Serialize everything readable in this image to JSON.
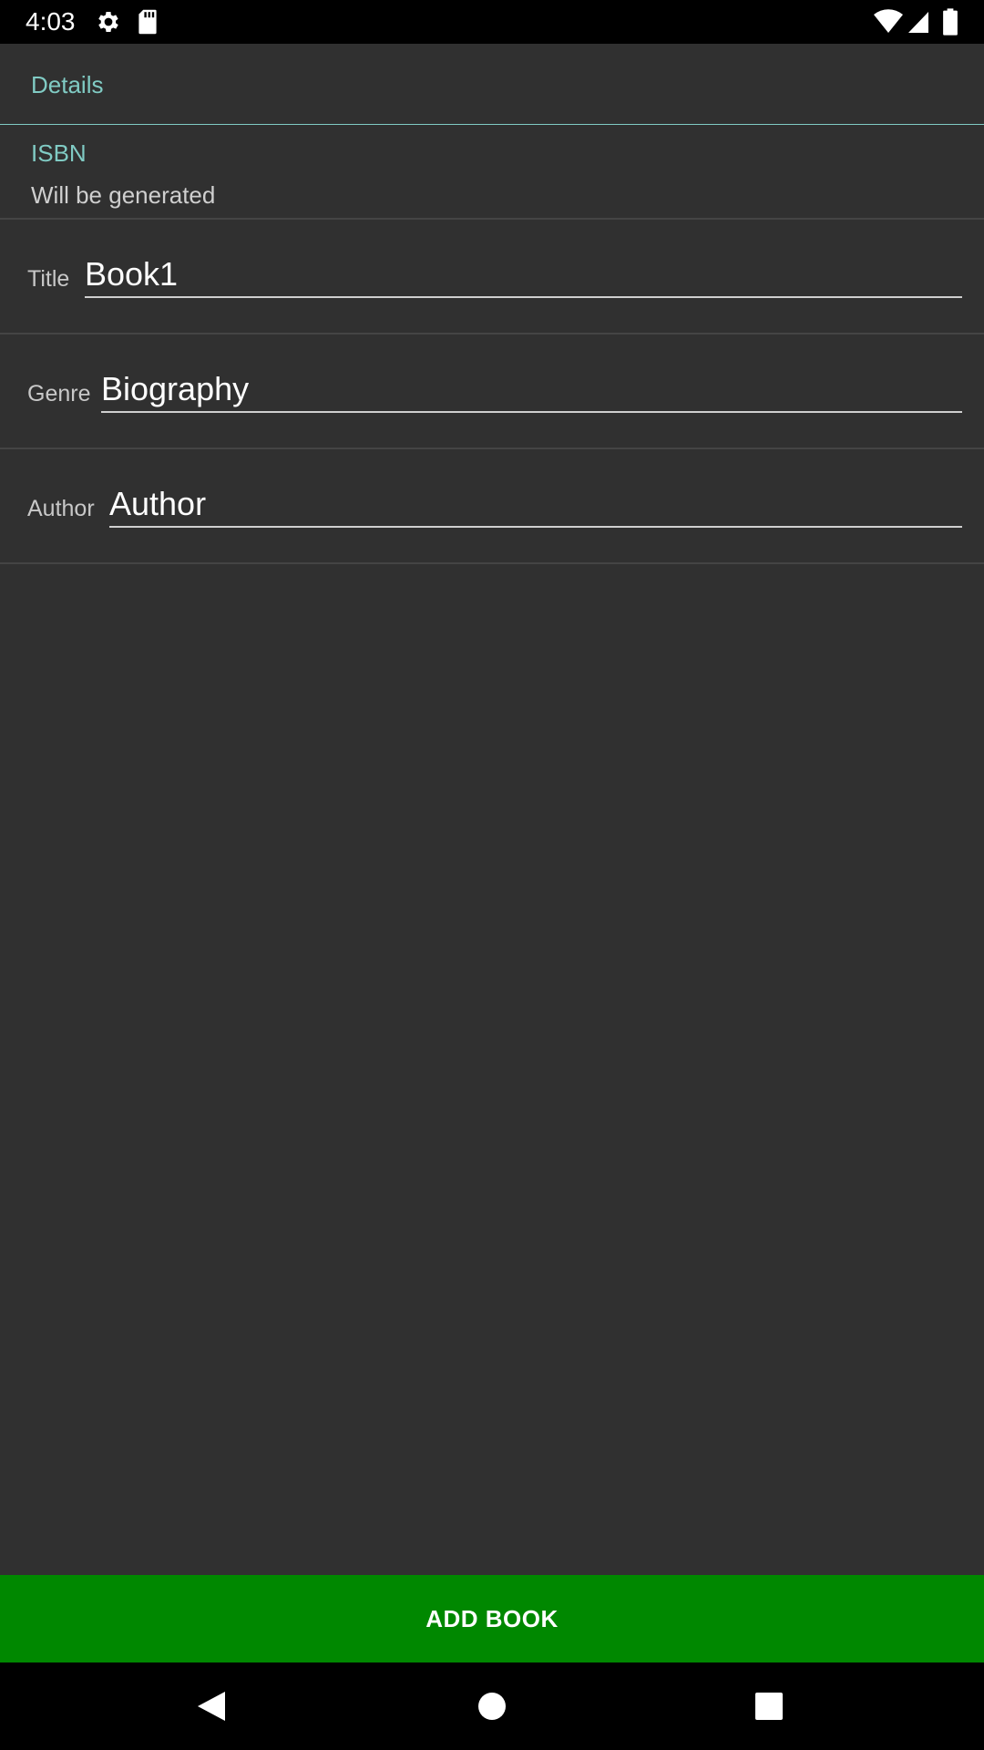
{
  "status_bar": {
    "time": "4:03",
    "icons": [
      "gear-icon",
      "sd-card-icon",
      "wifi-icon",
      "signal-icon",
      "battery-icon"
    ]
  },
  "header": {
    "title": "Details"
  },
  "isbn": {
    "label": "ISBN",
    "value": "Will be generated"
  },
  "form": {
    "title": {
      "label": "Title",
      "value": "Book1"
    },
    "genre": {
      "label": "Genre",
      "value": "Biography"
    },
    "author": {
      "label": "Author",
      "value": "Author"
    }
  },
  "actions": {
    "add_book_label": "ADD BOOK"
  },
  "nav": {
    "icons": [
      "back-icon",
      "home-icon",
      "recents-icon"
    ]
  },
  "colors": {
    "accent": "#80cbc4",
    "button": "#008800",
    "background": "#303030"
  }
}
